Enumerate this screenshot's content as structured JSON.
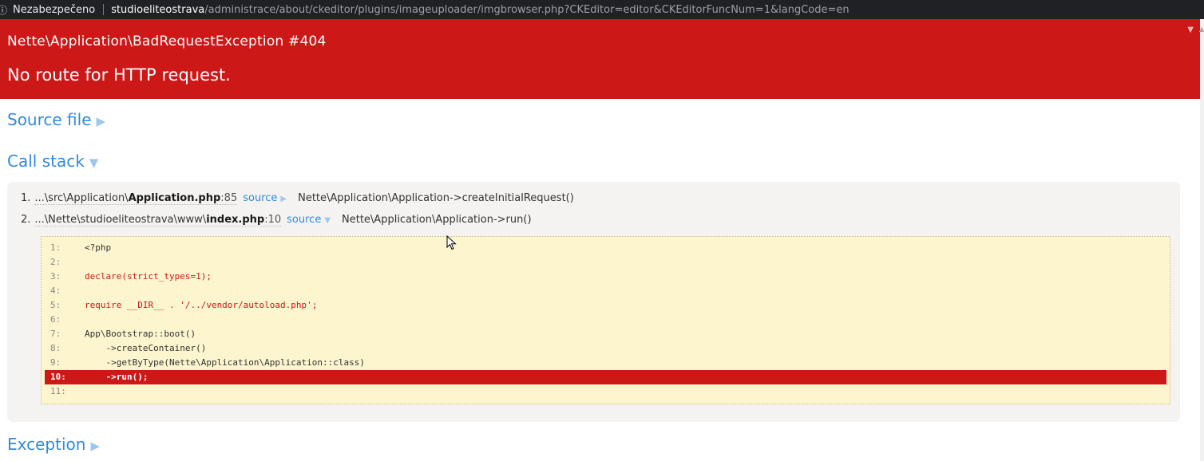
{
  "browser": {
    "security_label": "Nezabezpečeno",
    "host": "studioeliteostrava",
    "path": "/administrace/about/ckeditor/plugins/imageuploader/imgbrowser.php?CKEditor=editor&CKEditorFuncNum=1&langCode=en"
  },
  "error": {
    "exception": "Nette\\Application\\BadRequestException #404",
    "message": "No route for HTTP request."
  },
  "sections": {
    "source_file": "Source file",
    "call_stack": "Call stack",
    "exception": "Exception"
  },
  "stack": [
    {
      "index": "1.",
      "path_prefix": "...\\src\\Application\\",
      "file": "Application.php",
      "line": ":85",
      "source_label": "source",
      "call": "Nette\\Application\\Application->createInitialRequest()"
    },
    {
      "index": "2.",
      "path_prefix": "...\\Nette\\studioeliteostrava\\www\\",
      "file": "index.php",
      "line": ":10",
      "source_label": "source",
      "call": "Nette\\Application\\Application->run()"
    }
  ],
  "code_lines": [
    {
      "num": "1:",
      "text": "<?php"
    },
    {
      "num": "2:",
      "text": ""
    },
    {
      "num": "3:",
      "text": "declare(strict_types=1);"
    },
    {
      "num": "4:",
      "text": ""
    },
    {
      "num": "5:",
      "text": "require __DIR__ . '/../vendor/autoload.php';"
    },
    {
      "num": "6:",
      "text": ""
    },
    {
      "num": "7:",
      "text": "App\\Bootstrap::boot()"
    },
    {
      "num": "8:",
      "text": "    ->createContainer()"
    },
    {
      "num": "9:",
      "text": "    ->getByType(Nette\\Application\\Application::class)"
    },
    {
      "num": "10:",
      "text": "    ->run();"
    },
    {
      "num": "11:",
      "text": ""
    }
  ],
  "icons": {
    "info": "info-icon",
    "collapse": "triangle-down-icon",
    "expand": "triangle-right-icon",
    "cursor": "mouse-pointer-icon"
  },
  "colors": {
    "error_red": "#cd1818",
    "link_blue": "#328adc",
    "code_bg": "#fdf5ce",
    "stack_bg": "#f4f3f1"
  }
}
